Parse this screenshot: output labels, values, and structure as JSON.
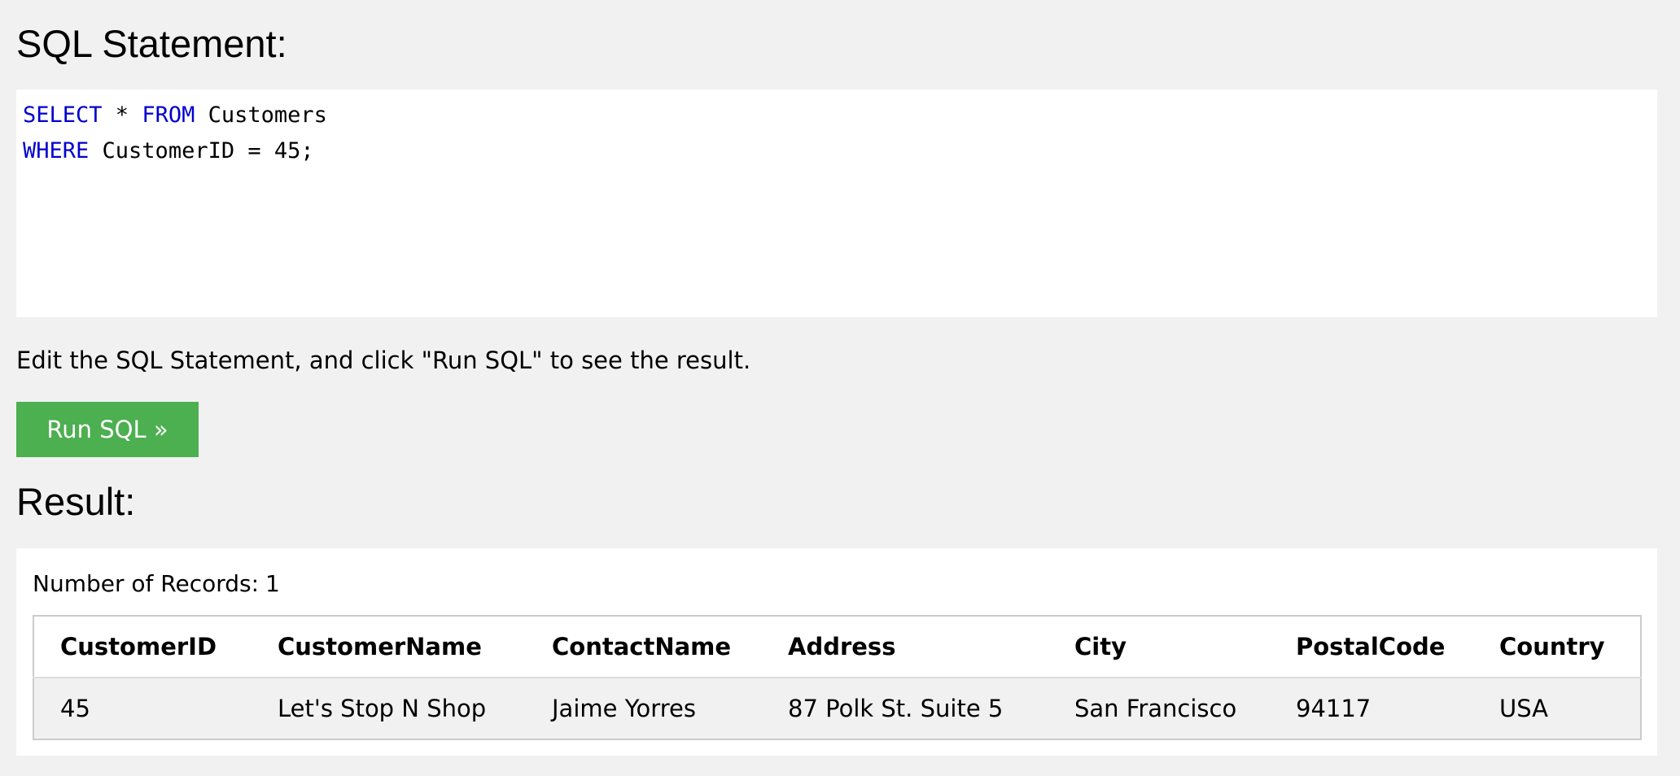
{
  "sql_heading": "SQL Statement:",
  "sql_editor": {
    "lines": [
      [
        {
          "text": "SELECT",
          "kind": "keyword"
        },
        {
          "text": " * ",
          "kind": "plain"
        },
        {
          "text": "FROM",
          "kind": "keyword"
        },
        {
          "text": " Customers",
          "kind": "plain"
        }
      ],
      [
        {
          "text": "WHERE",
          "kind": "keyword"
        },
        {
          "text": " CustomerID = 45;",
          "kind": "plain"
        }
      ]
    ]
  },
  "hint_text": "Edit the SQL Statement, and click \"Run SQL\" to see the result.",
  "run_button_label": "Run SQL »",
  "result_heading": "Result:",
  "result": {
    "records_label": "Number of Records:",
    "records_count": "1",
    "columns": [
      "CustomerID",
      "CustomerName",
      "ContactName",
      "Address",
      "City",
      "PostalCode",
      "Country"
    ],
    "rows": [
      [
        "45",
        "Let's Stop N Shop",
        "Jaime Yorres",
        "87 Polk St. Suite 5",
        "San Francisco",
        "94117",
        "USA"
      ]
    ]
  },
  "colors": {
    "page_background": "#f1f1f1",
    "keyword": "#0000cd",
    "run_button": "#4caf50",
    "run_button_text": "#ffffff"
  }
}
